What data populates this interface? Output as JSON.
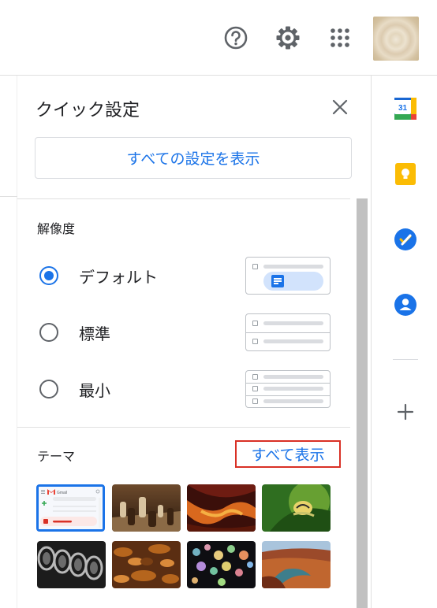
{
  "header": {
    "icons": [
      "help-icon",
      "settings-gear-icon",
      "apps-grid-icon"
    ]
  },
  "quick_settings": {
    "title": "クイック設定",
    "all_settings_button": "すべての設定を表示",
    "density": {
      "label": "解像度",
      "options": [
        {
          "label": "デフォルト",
          "selected": true
        },
        {
          "label": "標準",
          "selected": false
        },
        {
          "label": "最小",
          "selected": false
        }
      ]
    },
    "theme": {
      "label": "テーマ",
      "view_all_link": "すべて表示",
      "selected_thumbnail_logo": "Gmail",
      "thumbnails": [
        "default",
        "chess",
        "canyon",
        "leaf-snail",
        "tubes",
        "autumn-leaves",
        "bokeh-lights",
        "river-canyon"
      ]
    }
  },
  "side_panel": {
    "calendar_day": "31",
    "icons": [
      "google-calendar-icon",
      "google-keep-icon",
      "google-tasks-icon",
      "google-contacts-icon",
      "add-icon"
    ]
  },
  "colors": {
    "accent": "#1a73e8",
    "highlight_border": "#d93025",
    "calendar_blue": "#4285f4",
    "keep_yellow": "#fbbc04"
  }
}
